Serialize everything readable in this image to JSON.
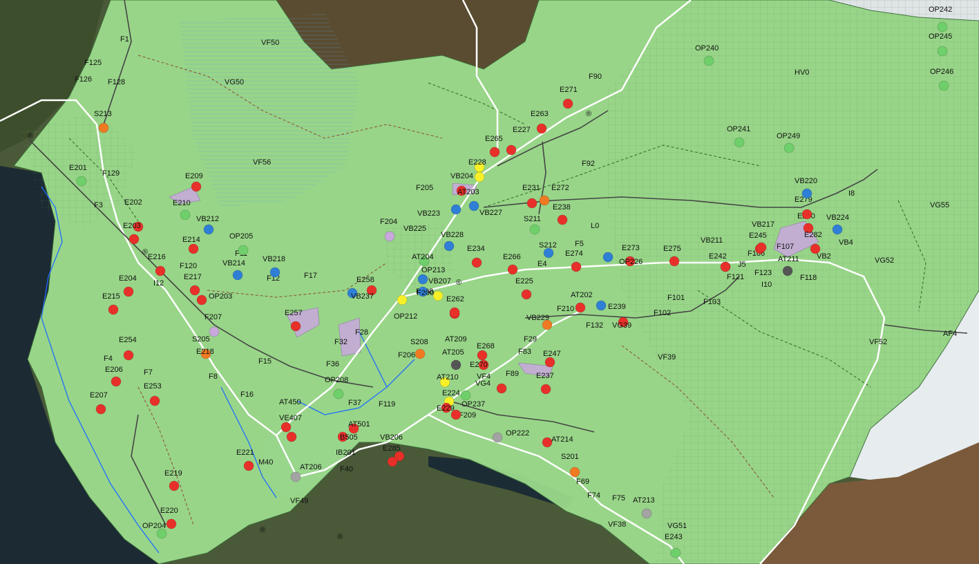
{
  "colors": {
    "red": "#e8302a",
    "orange": "#f07a22",
    "yellow": "#f7f029",
    "blue": "#2f7fd6",
    "green": "#6fcf6a",
    "purple": "#c9a8de",
    "gray": "#a3a3a3",
    "dark": "#555555",
    "zone_fill": "#9fe08f",
    "zone_stroke": "#3b6e3a"
  },
  "zone_labels": [
    {
      "text": "VF50",
      "cls": "zone"
    },
    {
      "text": "VG50",
      "cls": "zone"
    },
    {
      "text": "VF56",
      "cls": "zone"
    },
    {
      "text": "HV0",
      "cls": "zone"
    },
    {
      "text": "VG55",
      "cls": "zone"
    },
    {
      "text": "VG52",
      "cls": "zone"
    },
    {
      "text": "VF52",
      "cls": "zone"
    },
    {
      "text": "AF4",
      "cls": "zone"
    },
    {
      "text": "VF39",
      "cls": "zone"
    },
    {
      "text": "VF49",
      "cls": "zone"
    },
    {
      "text": "L0",
      "cls": "zone"
    },
    {
      "text": "F90",
      "cls": "zone"
    },
    {
      "text": "F92",
      "cls": "zone"
    },
    {
      "text": "F1",
      "cls": "zone"
    },
    {
      "text": "F125",
      "cls": "zone"
    },
    {
      "text": "F126",
      "cls": "zone"
    },
    {
      "text": "F128",
      "cls": "zone"
    },
    {
      "text": "F129",
      "cls": "zone"
    },
    {
      "text": "F3",
      "cls": "zone"
    },
    {
      "text": "F4",
      "cls": "zone"
    },
    {
      "text": "F7",
      "cls": "zone"
    },
    {
      "text": "F8",
      "cls": "zone"
    },
    {
      "text": "F15",
      "cls": "zone"
    },
    {
      "text": "F16",
      "cls": "zone"
    },
    {
      "text": "F17",
      "cls": "zone"
    },
    {
      "text": "F12",
      "cls": "zone"
    },
    {
      "text": "F11",
      "cls": "zone"
    },
    {
      "text": "F120",
      "cls": "zone"
    },
    {
      "text": "F207",
      "cls": "zone"
    },
    {
      "text": "F205",
      "cls": "zone"
    },
    {
      "text": "F204",
      "cls": "zone"
    },
    {
      "text": "F206",
      "cls": "zone"
    },
    {
      "text": "F208",
      "cls": "zone"
    },
    {
      "text": "F209",
      "cls": "zone"
    },
    {
      "text": "F210",
      "cls": "zone"
    },
    {
      "text": "F132",
      "cls": "zone"
    },
    {
      "text": "F101",
      "cls": "zone"
    },
    {
      "text": "F102",
      "cls": "zone"
    },
    {
      "text": "F103",
      "cls": "zone"
    },
    {
      "text": "F106",
      "cls": "zone"
    },
    {
      "text": "F107",
      "cls": "zone"
    },
    {
      "text": "F118",
      "cls": "zone"
    },
    {
      "text": "F121",
      "cls": "zone"
    },
    {
      "text": "F123",
      "cls": "zone"
    },
    {
      "text": "F89",
      "cls": "zone"
    },
    {
      "text": "F83",
      "cls": "zone"
    },
    {
      "text": "F29",
      "cls": "zone"
    },
    {
      "text": "F5",
      "cls": "zone"
    },
    {
      "text": "F69",
      "cls": "zone"
    },
    {
      "text": "F74",
      "cls": "zone"
    },
    {
      "text": "F75",
      "cls": "zone"
    },
    {
      "text": "F40",
      "cls": "zone"
    },
    {
      "text": "F37",
      "cls": "zone"
    },
    {
      "text": "F119",
      "cls": "zone"
    },
    {
      "text": "F36",
      "cls": "zone"
    },
    {
      "text": "F28",
      "cls": "zone"
    },
    {
      "text": "F32",
      "cls": "zone"
    },
    {
      "text": "I12",
      "cls": "zone"
    },
    {
      "text": "I10",
      "cls": "zone"
    },
    {
      "text": "I8",
      "cls": "zone"
    },
    {
      "text": "J5",
      "cls": "zone"
    },
    {
      "text": "E4",
      "cls": "zone"
    },
    {
      "text": "VF38",
      "cls": "zone"
    },
    {
      "text": "VG51",
      "cls": "zone"
    },
    {
      "text": "VB4",
      "cls": "zone"
    },
    {
      "text": "VB2",
      "cls": "zone"
    },
    {
      "text": "M40",
      "cls": "zone"
    },
    {
      "text": "IB201",
      "cls": "zone"
    }
  ],
  "markers": [
    {
      "label": "S213",
      "color": "orange"
    },
    {
      "label": "E201",
      "color": "green"
    },
    {
      "label": "E209",
      "color": "red"
    },
    {
      "label": "E210",
      "color": "green"
    },
    {
      "label": "E202",
      "color": "red"
    },
    {
      "label": "E203",
      "color": "red"
    },
    {
      "label": "VB212",
      "color": "blue"
    },
    {
      "label": "OP205",
      "color": "green"
    },
    {
      "label": "E214",
      "color": "red"
    },
    {
      "label": "E216",
      "color": "red"
    },
    {
      "label": "VB214",
      "color": "blue"
    },
    {
      "label": "VB218",
      "color": "blue"
    },
    {
      "label": "E217",
      "color": "red"
    },
    {
      "label": "E204",
      "color": "red"
    },
    {
      "label": "E215",
      "color": "red"
    },
    {
      "label": "OP203",
      "color": "red"
    },
    {
      "label": "E257",
      "color": "red"
    },
    {
      "label": "S205",
      "color": "purple"
    },
    {
      "label": "E218",
      "color": "orange"
    },
    {
      "label": "E254",
      "color": "red"
    },
    {
      "label": "E206",
      "color": "red"
    },
    {
      "label": "E253",
      "color": "red"
    },
    {
      "label": "E207",
      "color": "red"
    },
    {
      "label": "E219",
      "color": "red"
    },
    {
      "label": "E220",
      "color": "red"
    },
    {
      "label": "OP204",
      "color": "green"
    },
    {
      "label": "E221",
      "color": "red"
    },
    {
      "label": "AT450",
      "color": "red"
    },
    {
      "label": "VE407",
      "color": "red"
    },
    {
      "label": "AT206",
      "color": "gray"
    },
    {
      "label": "VB206",
      "color": "red"
    },
    {
      "label": "E285",
      "color": "red"
    },
    {
      "label": "AT501",
      "color": "red"
    },
    {
      "label": "B505",
      "color": "red"
    },
    {
      "label": "OP208",
      "color": "green"
    },
    {
      "label": "S208",
      "color": "orange"
    },
    {
      "label": "E258",
      "color": "red"
    },
    {
      "label": "VB237",
      "color": "blue"
    },
    {
      "label": "OP212",
      "color": "yellow"
    },
    {
      "label": "OP213",
      "color": "blue"
    },
    {
      "label": "AT204",
      "color": "green"
    },
    {
      "label": "VB207",
      "color": "yellow"
    },
    {
      "label": "E262",
      "color": "red"
    },
    {
      "label": "F200",
      "color": "blue"
    },
    {
      "label": "VB225",
      "color": "purple"
    },
    {
      "label": "VB228",
      "color": "blue"
    },
    {
      "label": "E234",
      "color": "red"
    },
    {
      "label": "VB223",
      "color": "blue"
    },
    {
      "label": "VB204",
      "color": "yellow"
    },
    {
      "label": "AT203",
      "color": "red"
    },
    {
      "label": "VB227",
      "color": "blue"
    },
    {
      "label": "E228",
      "color": "yellow"
    },
    {
      "label": "E265",
      "color": "red"
    },
    {
      "label": "E227",
      "color": "red"
    },
    {
      "label": "E263",
      "color": "red"
    },
    {
      "label": "E271",
      "color": "red"
    },
    {
      "label": "E231",
      "color": "red"
    },
    {
      "label": "E272",
      "color": "orange"
    },
    {
      "label": "E238",
      "color": "red"
    },
    {
      "label": "S211",
      "color": "green"
    },
    {
      "label": "S212",
      "color": "blue"
    },
    {
      "label": "E266",
      "color": "red"
    },
    {
      "label": "E225",
      "color": "red"
    },
    {
      "label": "E274",
      "color": "red"
    },
    {
      "label": "E273",
      "color": "blue"
    },
    {
      "label": "OP226",
      "color": "red"
    },
    {
      "label": "E275",
      "color": "red"
    },
    {
      "label": "VB211",
      "color": "red"
    },
    {
      "label": "E242",
      "color": "red"
    },
    {
      "label": "E245",
      "color": "red"
    },
    {
      "label": "VB217",
      "color": "red"
    },
    {
      "label": "E280",
      "color": "red"
    },
    {
      "label": "E279",
      "color": "red"
    },
    {
      "label": "VB220",
      "color": "blue"
    },
    {
      "label": "VB224",
      "color": "blue"
    },
    {
      "label": "E282",
      "color": "red"
    },
    {
      "label": "AT211",
      "color": "dark"
    },
    {
      "label": "AT202",
      "color": "red"
    },
    {
      "label": "E239",
      "color": "blue"
    },
    {
      "label": "VG39",
      "color": "red"
    },
    {
      "label": "VB229",
      "color": "orange"
    },
    {
      "label": "AT209",
      "color": "red"
    },
    {
      "label": "AT205",
      "color": "dark"
    },
    {
      "label": "E268",
      "color": "red"
    },
    {
      "label": "E270",
      "color": "red"
    },
    {
      "label": "E247",
      "color": "red"
    },
    {
      "label": "E237",
      "color": "red"
    },
    {
      "label": "VG4",
      "color": "red"
    },
    {
      "label": "AT210",
      "color": "yellow"
    },
    {
      "label": "E224",
      "color": "yellow"
    },
    {
      "label": "E229",
      "color": "red"
    },
    {
      "label": "OP237",
      "color": "red"
    },
    {
      "label": "VF4",
      "color": "green"
    },
    {
      "label": "OP222",
      "color": "gray"
    },
    {
      "label": "AT214",
      "color": "red"
    },
    {
      "label": "S201",
      "color": "orange"
    },
    {
      "label": "AT213",
      "color": "gray"
    },
    {
      "label": "E243",
      "color": "green"
    },
    {
      "label": "OP240",
      "color": "green"
    },
    {
      "label": "OP241",
      "color": "green"
    },
    {
      "label": "OP249",
      "color": "green"
    },
    {
      "label": "OP242",
      "color": "green"
    },
    {
      "label": "OP245",
      "color": "green"
    },
    {
      "label": "OP246",
      "color": "green"
    }
  ],
  "road_symbols": [
    "®",
    "®",
    "®",
    "®",
    "®",
    "®"
  ]
}
